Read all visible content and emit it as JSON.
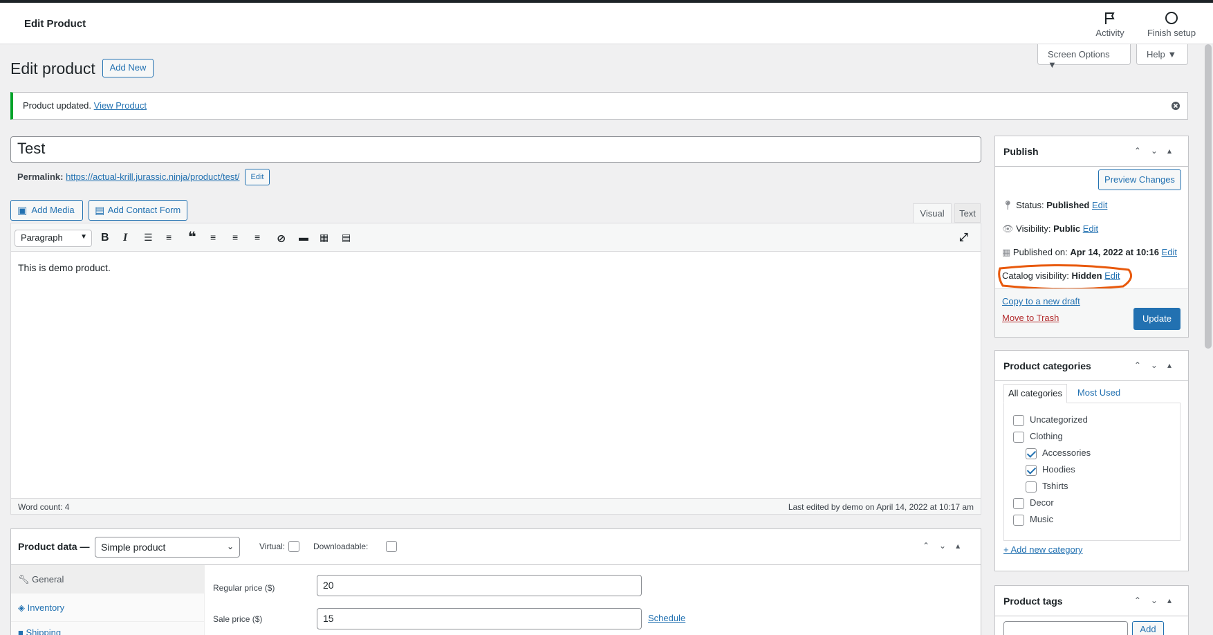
{
  "header": {
    "title": "Edit Product",
    "activity": "Activity",
    "finish_setup": "Finish setup"
  },
  "screen_options": "Screen Options ▼",
  "help": "Help ▼",
  "page": {
    "title": "Edit product",
    "add_new": "Add New"
  },
  "notice": {
    "text": "Product updated.",
    "link": "View Product"
  },
  "product": {
    "title": "Test",
    "permalink_label": "Permalink:",
    "permalink_url": "https://actual-krill.jurassic.ninja/product/test/",
    "permalink_edit": "Edit"
  },
  "editor": {
    "add_media": "Add Media",
    "add_contact_form": "Add Contact Form",
    "tab_visual": "Visual",
    "tab_text": "Text",
    "format": "Paragraph",
    "content": "This is demo product.",
    "word_count": "Word count: 4",
    "last_edited": "Last edited by demo on April 14, 2022 at 10:17 am"
  },
  "publish": {
    "title": "Publish",
    "preview": "Preview Changes",
    "status_label": "Status:",
    "status_value": "Published",
    "visibility_label": "Visibility:",
    "visibility_value": "Public",
    "published_label": "Published on:",
    "published_value": "Apr 14, 2022 at 10:16",
    "catalog_label": "Catalog visibility:",
    "catalog_value": "Hidden",
    "edit": "Edit",
    "copy_draft": "Copy to a new draft",
    "trash": "Move to Trash",
    "update": "Update"
  },
  "categories": {
    "title": "Product categories",
    "tab_all": "All categories",
    "tab_most": "Most Used",
    "items": [
      {
        "label": "Uncategorized",
        "checked": false
      },
      {
        "label": "Clothing",
        "checked": false
      },
      {
        "label": "Accessories",
        "checked": true
      },
      {
        "label": "Hoodies",
        "checked": true
      },
      {
        "label": "Tshirts",
        "checked": false
      },
      {
        "label": "Decor",
        "checked": false
      },
      {
        "label": "Music",
        "checked": false
      }
    ],
    "add_new": "+ Add new category"
  },
  "tags": {
    "title": "Product tags",
    "add": "Add"
  },
  "product_data": {
    "label": "Product data —",
    "type": "Simple product",
    "virtual": "Virtual:",
    "downloadable": "Downloadable:",
    "tabs": [
      "General",
      "Inventory",
      "Shipping"
    ],
    "regular_price_label": "Regular price ($)",
    "regular_price": "20",
    "sale_price_label": "Sale price ($)",
    "sale_price": "15",
    "schedule": "Schedule"
  },
  "colors": {
    "accent": "#2271b1",
    "annotation": "#e8590c",
    "success": "#00a32a",
    "trash": "#b32d2e"
  }
}
